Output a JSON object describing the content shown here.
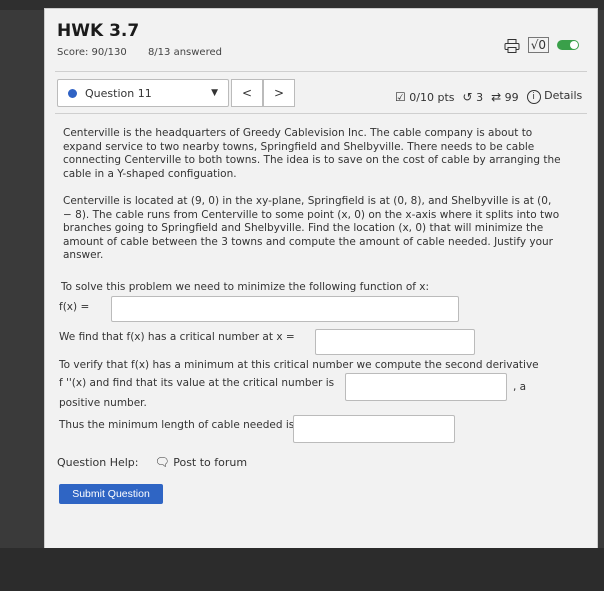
{
  "header": {
    "title": "HWK 3.7",
    "score": "Score: 90/130",
    "answered": "8/13 answered"
  },
  "question_bar": {
    "question_label": "Question 11",
    "prev": "<",
    "next": ">",
    "points": "0/10 pts",
    "retries": "3",
    "attempts": "99",
    "details": "Details"
  },
  "problem": {
    "p1": "Centerville is the headquarters of Greedy Cablevision Inc. The cable company is about to expand service to two nearby towns, Springfield and Shelbyville. There needs to be cable connecting Centerville to both towns. The idea is to save on the cost of cable by arranging the cable in a Y-shaped configuation.",
    "p2": "Centerville is located at (9, 0) in the xy-plane, Springfield is at (0, 8), and Shelbyville is at (0, − 8). The cable runs from Centerville to some point (x, 0) on the x-axis where it splits into two branches going to Springfield and Shelbyville. Find the location (x, 0) that will minimize the amount of cable between the 3 towns and compute the amount of cable needed. Justify your answer.",
    "solve": "To solve this problem we need to minimize the following function of x:",
    "fx_label": "f(x) =",
    "critical": "We find that f(x) has a critical number at x =",
    "verify": "To verify that f(x) has a minimum at this critical number we compute the second derivative",
    "second": "f ''(x) and find that its value at the critical number is",
    "comma_a": ", a",
    "positive": "positive number.",
    "minimum": "Thus the minimum length of cable needed is"
  },
  "help": {
    "label": "Question Help:",
    "post": "Post to forum"
  },
  "submit_label": "Submit Question",
  "colors": {
    "accent": "#2f65c4",
    "toggle": "#3aa04a"
  }
}
